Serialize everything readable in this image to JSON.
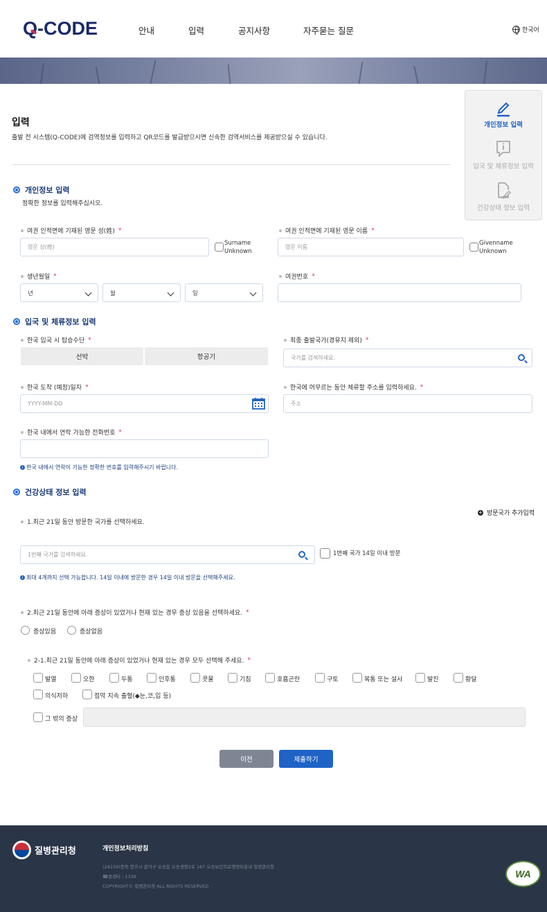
{
  "header": {
    "logo": "Q-CODE",
    "nav": [
      "안내",
      "입력",
      "공지사항",
      "자주묻는 질문"
    ],
    "language": "한국어"
  },
  "steps": [
    {
      "label": "개인정보 입력",
      "icon": "pencil-icon",
      "active": true
    },
    {
      "label": "입국 및 체류정보 입력",
      "icon": "info-icon",
      "active": false
    },
    {
      "label": "건강상태 정보 입력",
      "icon": "document-edit-icon",
      "active": false
    }
  ],
  "page": {
    "title": "입력",
    "description": "출발 전 시스템(Q-CODE)에 검역정보를 입력하고 QR코드를 발급받으시면 신속한 검역서비스를 제공받으실 수 있습니다."
  },
  "personal": {
    "title": "개인정보 입력",
    "subtitle": "정확한 정보를 입력해주십시오.",
    "surname_label": "여권 인적면에 기재된 영문 성(姓)",
    "surname_placeholder": "영문 성(姓)",
    "surname_unknown": "Surname Unknown",
    "given_label": "여권 인적면에 기재된 영문 이름",
    "given_placeholder": "영문 이름",
    "given_unknown": "Givenname Unknown",
    "birth_label": "생년월일",
    "birth_year": "년",
    "birth_month": "월",
    "birth_day": "일",
    "passport_label": "여권번호",
    "required_mark": "*"
  },
  "entry": {
    "title": "입국 및 체류정보 입력",
    "transport_label": "한국 입국 시 탑승수단",
    "transport_options": [
      "선박",
      "항공기"
    ],
    "departure_label": "최종 출발국가(경유지 제외)",
    "departure_placeholder": "국가를 검색하세요.",
    "arrival_label": "한국 도착 (예정)일자",
    "arrival_placeholder": "YYYY-MM-DD",
    "address_label": "한국에 머무르는 동안 체류할 주소를 입력하세요.",
    "address_placeholder": "주소",
    "phone_label": "한국 내에서 연락 가능한 전화번호",
    "phone_notice": "한국 내에서 연락이 가능한 정확한 번호를 입력해주시기 바랍니다."
  },
  "health": {
    "title": "건강상태 정보 입력",
    "add_country": "방문국가 추가입력",
    "q1": "1.최근 21일 동안 방문한 국가를 선택하세요.",
    "q1_placeholder": "1번째 국가를 검색하세요.",
    "q1_within14": "1번째 국가 14일 이내 방문",
    "q1_notice": "최대 4개까지 선택 가능합니다. 14일 이내에 방문한 경우 14일 이내 방문을 선택해주세요.",
    "q2": "2.최근 21일 동안에 아래 증상이 있었거나 현재 있는 경우 증상 있음을 선택하세요.",
    "q2_options": [
      "증상있음",
      "증상없음"
    ],
    "q21": "2-1.최근 21일 동안에 아래 증상이 있었거나 현재 있는 경우 모두 선택해 주세요.",
    "symptoms_row1": [
      "발열",
      "오한",
      "두통",
      "인후통",
      "콧물",
      "기침",
      "호흡곤란",
      "구토",
      "복통 또는 설사",
      "발진",
      "황달"
    ],
    "symptoms_row2": [
      "의식저하",
      "점막 지속 출혈(◆눈,코,입 등)"
    ],
    "other_symptom": "그 밖의 증상"
  },
  "buttons": {
    "prev": "이전",
    "submit": "제출하기"
  },
  "footer": {
    "org": "질병관리청",
    "privacy": "개인정보처리방침",
    "address": "(28159)충북 청주시 흥덕구 오송읍 오송생명2로 187 오송보건의료행정타운내 질병관리청",
    "phone": "☎콜센터 : 1339",
    "copyright": "COPYRIGHT© 질병관리청 ALL RIGHTS RESERVED",
    "badge": "WA"
  },
  "colors": {
    "primary": "#1f63c6",
    "heading": "#1b3c7a",
    "required": "#d8364a",
    "prev_button": "#7f8693",
    "footer_bg": "#2a3547"
  }
}
